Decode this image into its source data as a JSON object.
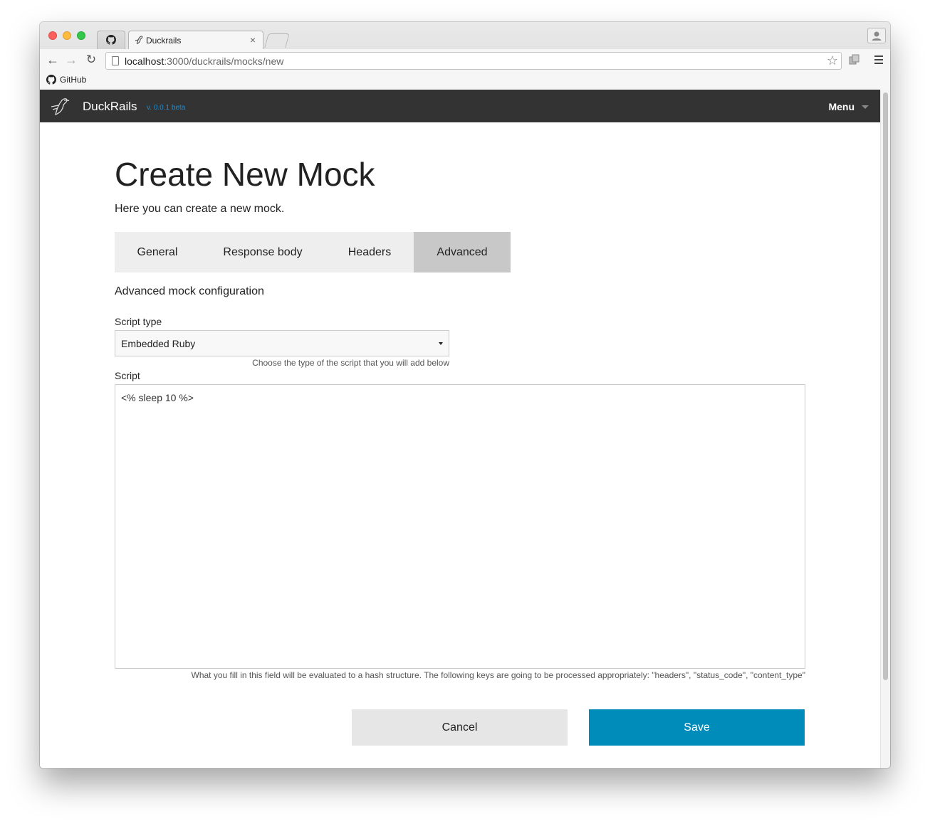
{
  "browser": {
    "tabs": [
      {
        "title": "",
        "icon": "github-icon",
        "pinned": true
      },
      {
        "title": "Duckrails",
        "icon": "duck-icon",
        "active": true
      }
    ],
    "url_host": "localhost",
    "url_path": ":3000/duckrails/mocks/new",
    "bookmarks": [
      {
        "label": "GitHub",
        "icon": "github-icon"
      }
    ]
  },
  "navbar": {
    "brand": "DuckRails",
    "version": "v. 0.0.1 beta",
    "menu_label": "Menu"
  },
  "page": {
    "title": "Create New Mock",
    "subtitle": "Here you can create a new mock.",
    "tabs": [
      {
        "label": "General"
      },
      {
        "label": "Response body"
      },
      {
        "label": "Headers"
      },
      {
        "label": "Advanced",
        "active": true
      }
    ],
    "section_title": "Advanced mock configuration",
    "script_type": {
      "label": "Script type",
      "value": "Embedded Ruby",
      "help": "Choose the type of the script that you will add below"
    },
    "script": {
      "label": "Script",
      "value": "<% sleep 10 %>",
      "help": "What you fill in this field will be evaluated to a hash structure. The following keys are going to be processed appropriately: \"headers\", \"status_code\", \"content_type\""
    },
    "cancel_label": "Cancel",
    "save_label": "Save"
  },
  "colors": {
    "navbar_bg": "#333333",
    "save_button": "#008cba",
    "version_text": "#1c8fd6"
  }
}
